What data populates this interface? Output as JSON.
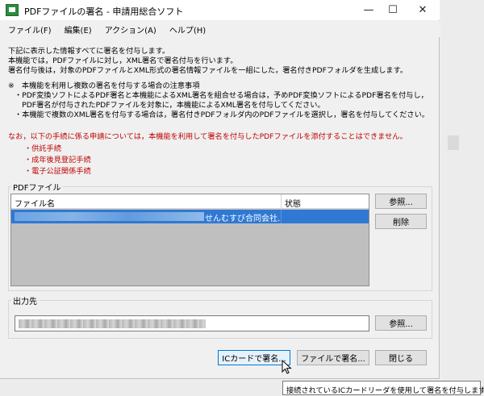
{
  "window": {
    "title": "PDFファイルの署名 - 申請用総合ソフト",
    "min_glyph": "—",
    "max_glyph": "☐",
    "close_glyph": "✕"
  },
  "menu": [
    {
      "label": "ファイル(F)"
    },
    {
      "label": "編集(E)"
    },
    {
      "label": "アクション(A)"
    },
    {
      "label": "ヘルプ(H)"
    }
  ],
  "intro": {
    "line1": "下記に表示した情報すべてに署名を付与します。",
    "line2": "本機能では，PDFファイルに対し，XML署名で署名付与を行います。",
    "line3": "署名付与後は，対象のPDFファイルとXML形式の署名情報ファイルを一組にした，署名付きPDFフォルダを生成します。"
  },
  "notes": {
    "heading": "※　本機能を利用し複数の署名を付与する場合の注意事項",
    "item1a": "・PDF変換ソフトによるPDF署名と本機能によるXML署名を組合せる場合は，予めPDF変換ソフトによるPDF署名を付与し，",
    "item1b": "　PDF署名が付与されたPDFファイルを対象に，本機能によるXML署名を付与してください。",
    "item2": "・本機能で複数のXML署名を付与する場合は，署名付きPDFフォルダ内のPDFファイルを選択し，署名を付与してください。"
  },
  "warning": {
    "text": "なお，以下の手続に係る申請については，本機能を利用して署名を付与したPDFファイルを添付することはできません。",
    "items": [
      "・供託手続",
      "・成年後見登記手続",
      "・電子公証関係手続"
    ]
  },
  "pdf_group": {
    "label": "PDFファイル",
    "col_filename": "ファイル名",
    "col_status": "状態",
    "row_visible_text": "せんむすび合同会社...",
    "browse_button": "参照...",
    "delete_button": "削除"
  },
  "output_group": {
    "label": "出力先",
    "browse_button": "参照..."
  },
  "actions": {
    "ic_card_sign": "ICカードで署名...",
    "file_sign": "ファイルで署名...",
    "close": "閉じる"
  },
  "tooltip": {
    "text": "接続されているICカードリーダを使用して署名を付与します。"
  },
  "icons": {
    "app": "app-icon",
    "cursor": "mouse-pointer-icon"
  },
  "colors": {
    "accent": "#0078d7",
    "selection": "#2f79d4",
    "warning_red": "#c00000"
  }
}
